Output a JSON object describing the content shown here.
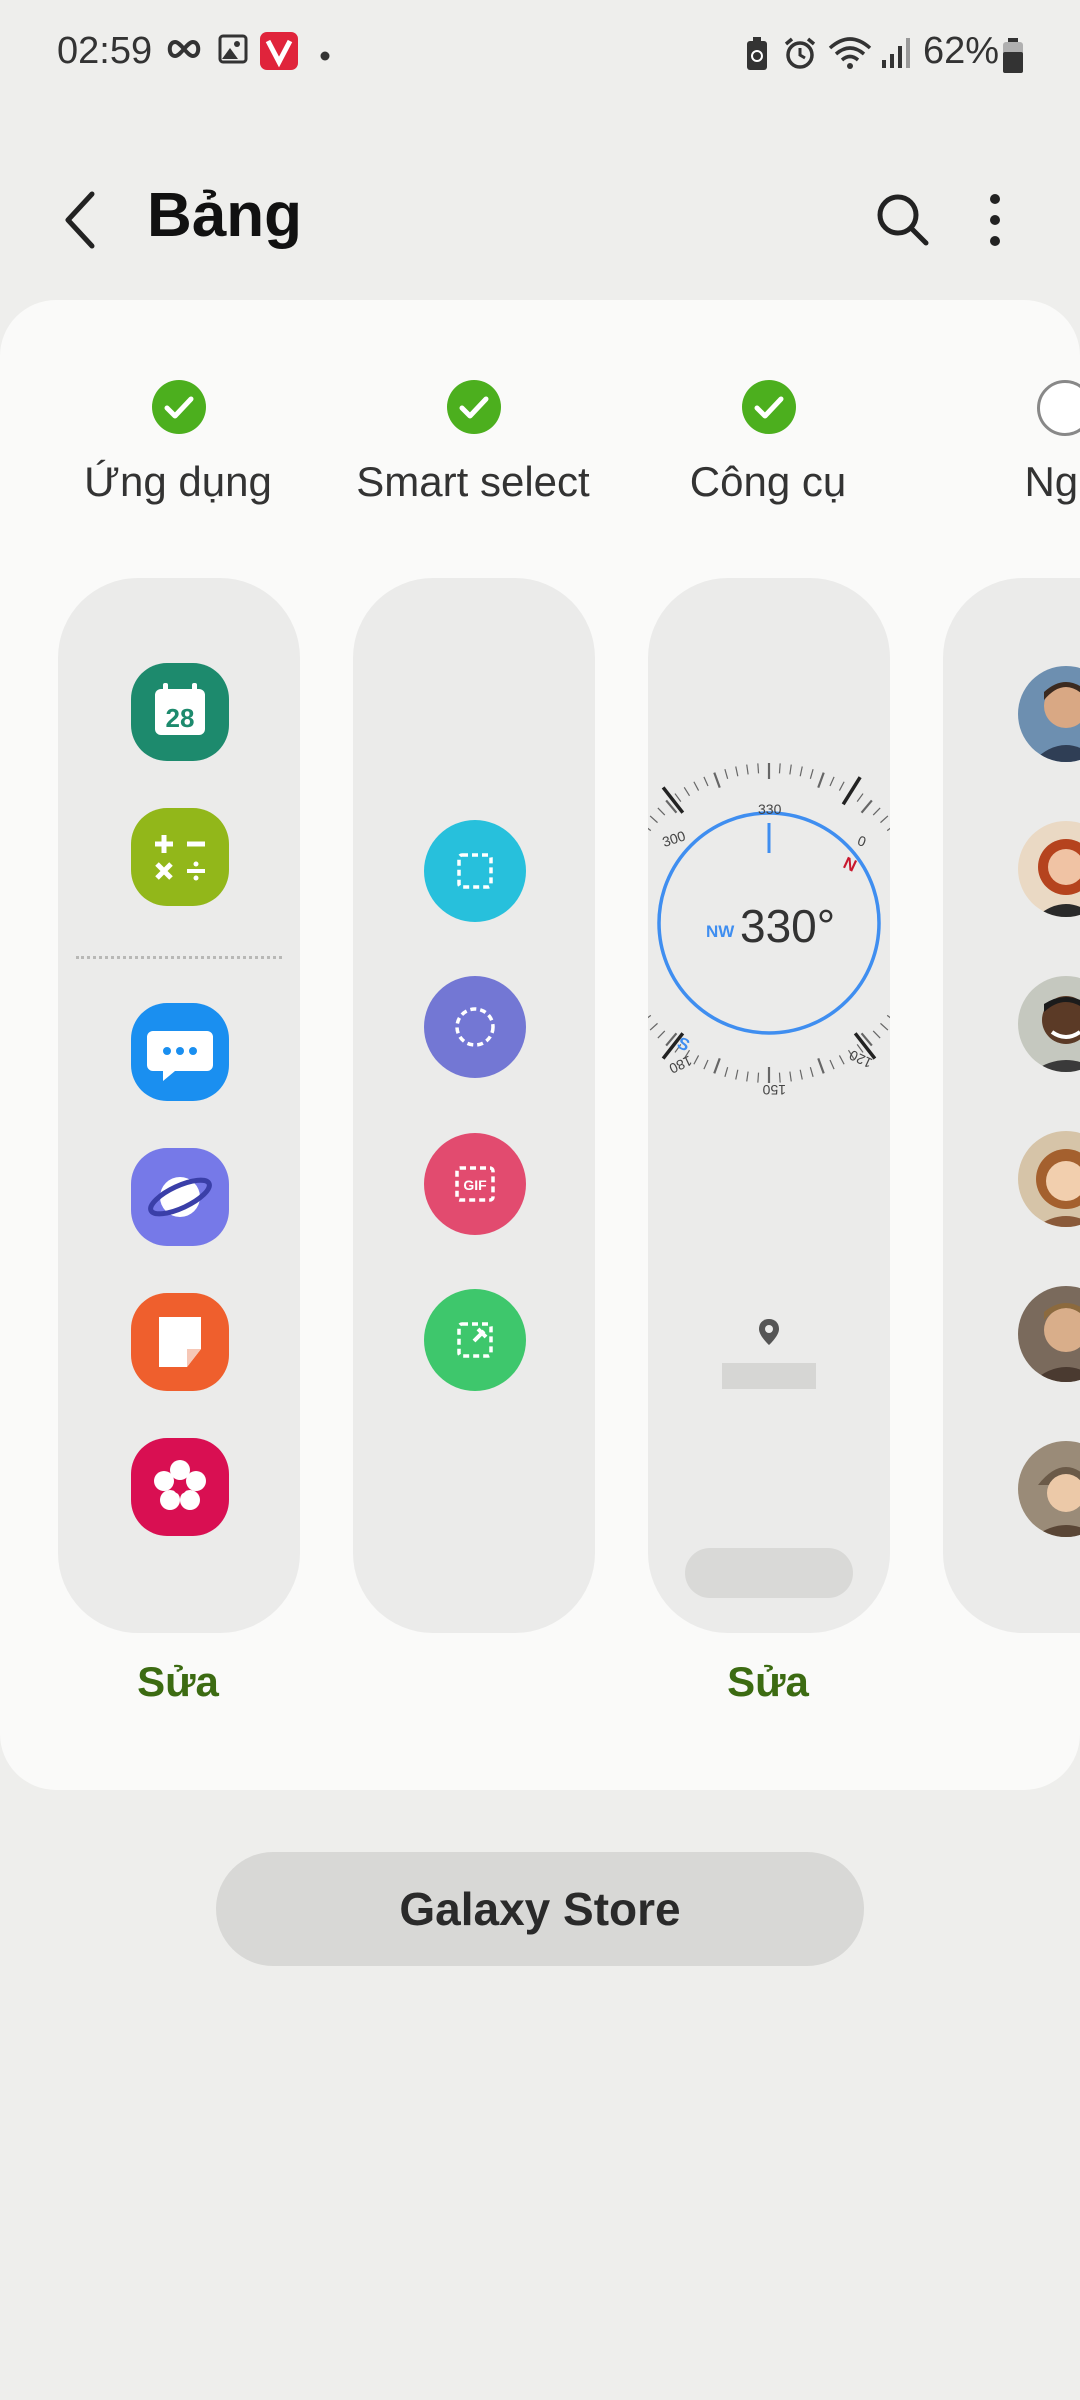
{
  "status_bar": {
    "time": "02:59",
    "battery": "62%",
    "left_icons": [
      "infinity-icon",
      "gallery-icon",
      "vivaldi-icon",
      "dot-icon"
    ],
    "right_icons": [
      "battery-saver-icon",
      "alarm-icon",
      "wifi-icon",
      "signal-icon",
      "battery-icon"
    ]
  },
  "header": {
    "title": "Bảng",
    "back_icon": "back-icon",
    "search_icon": "search-icon",
    "more_icon": "more-options-icon"
  },
  "panels": [
    {
      "label": "Ứng dụng",
      "checked": true,
      "edit_label": "Sửa",
      "apps": [
        "calendar",
        "calculator",
        "messages",
        "internet",
        "notes",
        "gallery"
      ],
      "calendar_day": "28"
    },
    {
      "label": "Smart select",
      "checked": true,
      "tools": [
        "rectangle-select",
        "oval-select",
        "animation-gif",
        "pin-to-screen"
      ]
    },
    {
      "label": "Công cụ",
      "checked": true,
      "edit_label": "Sửa",
      "compass": {
        "direction": "NW",
        "heading": "330°",
        "ticks": [
          "300",
          "330",
          "0",
          "120",
          "150",
          "180"
        ],
        "north": "N",
        "south": "S"
      }
    },
    {
      "label": "Ngu",
      "checked": false,
      "contacts": 6
    }
  ],
  "galaxy_store_label": "Galaxy Store",
  "colors": {
    "accent_green": "#4caf1e",
    "edit_green": "#3c6b12",
    "compass_blue": "#3f8ef0"
  }
}
